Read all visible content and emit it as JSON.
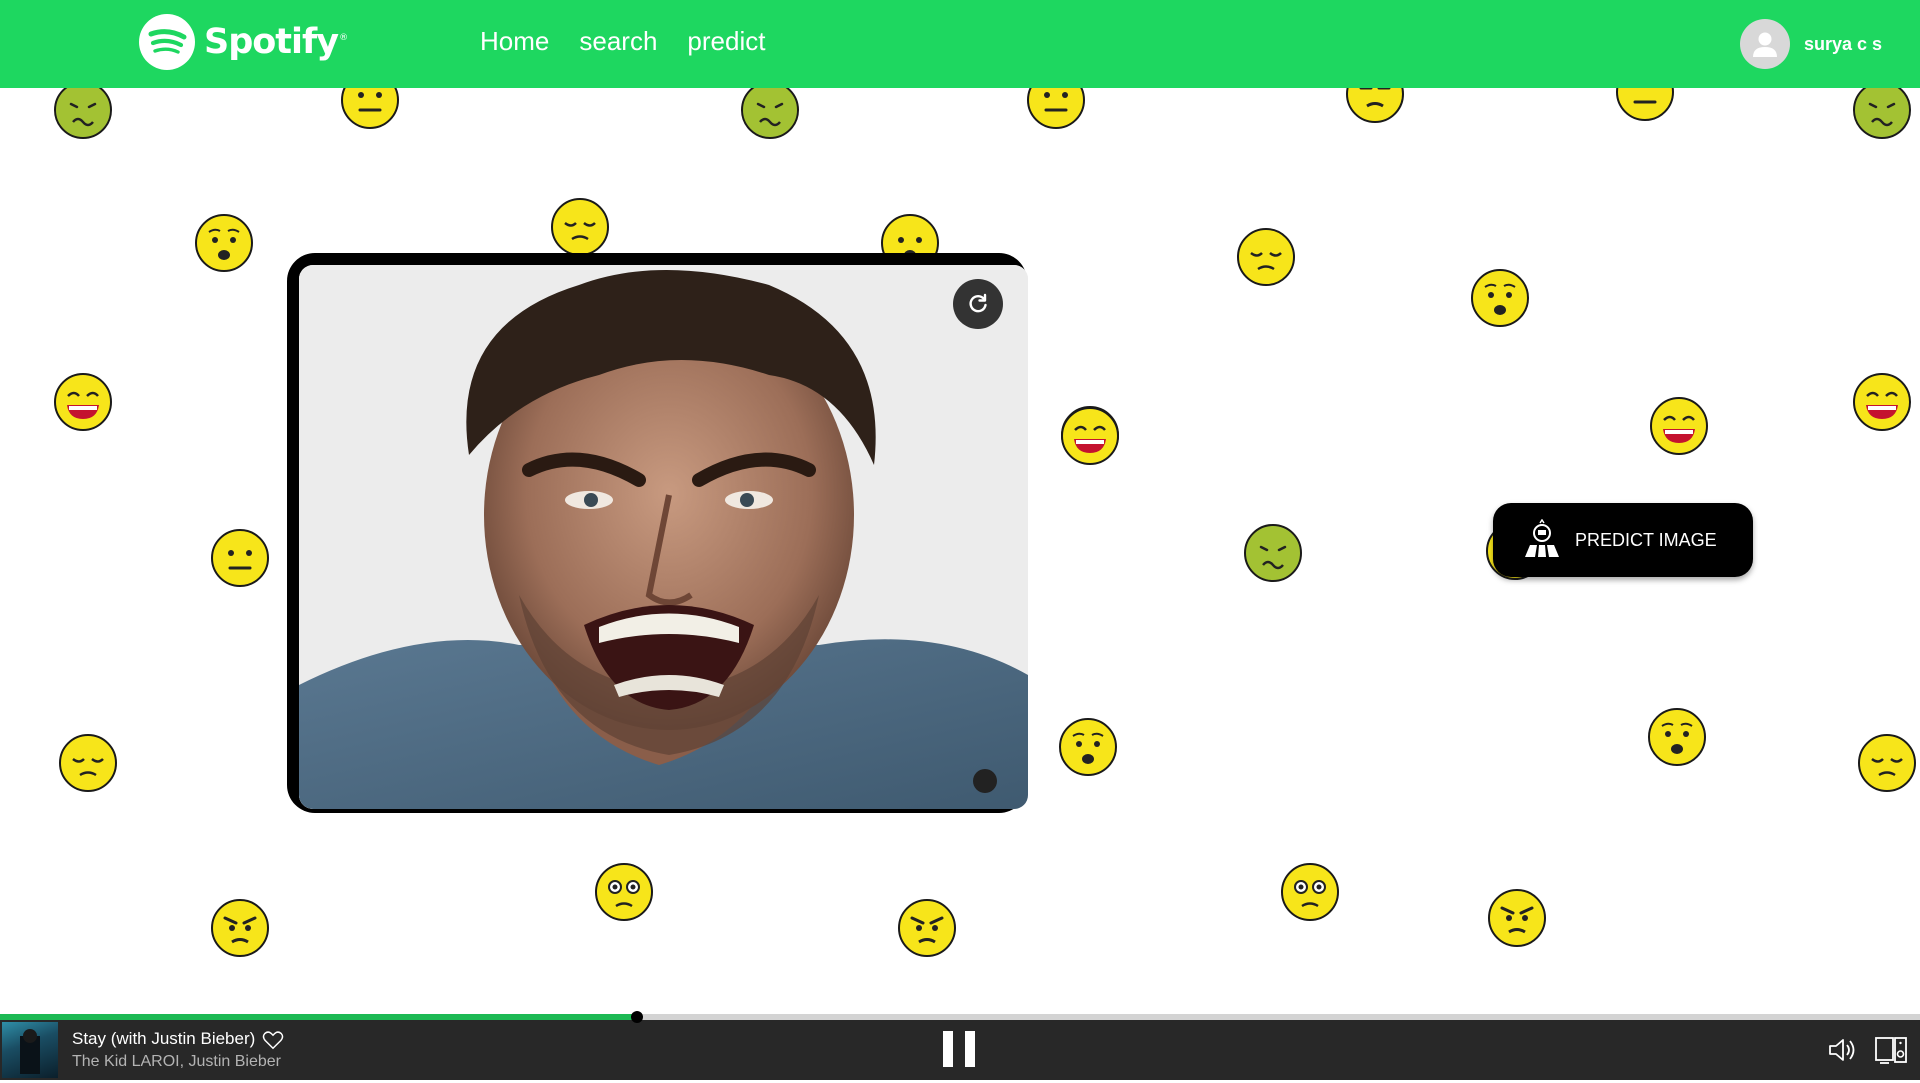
{
  "header": {
    "brand": "Spotify",
    "brand_mark": "®",
    "nav": [
      "Home",
      "search",
      "predict"
    ],
    "user_name": "surya c s",
    "bg_color": "#1ed760"
  },
  "emoji_icons": [
    "nauseated-face",
    "neutral-face",
    "hushed-face",
    "relieved-face",
    "grinning-face",
    "flushed-face",
    "angry-face",
    "unamused-face",
    "expressionless-face"
  ],
  "main": {
    "image_subject": "angry-man-photo",
    "predict_button_label": "PREDICT IMAGE"
  },
  "player": {
    "track_title": "Stay (with Justin Bieber)",
    "track_artist": "The Kid LAROI, Justin Bieber",
    "progress": 0.332,
    "state": "playing"
  }
}
